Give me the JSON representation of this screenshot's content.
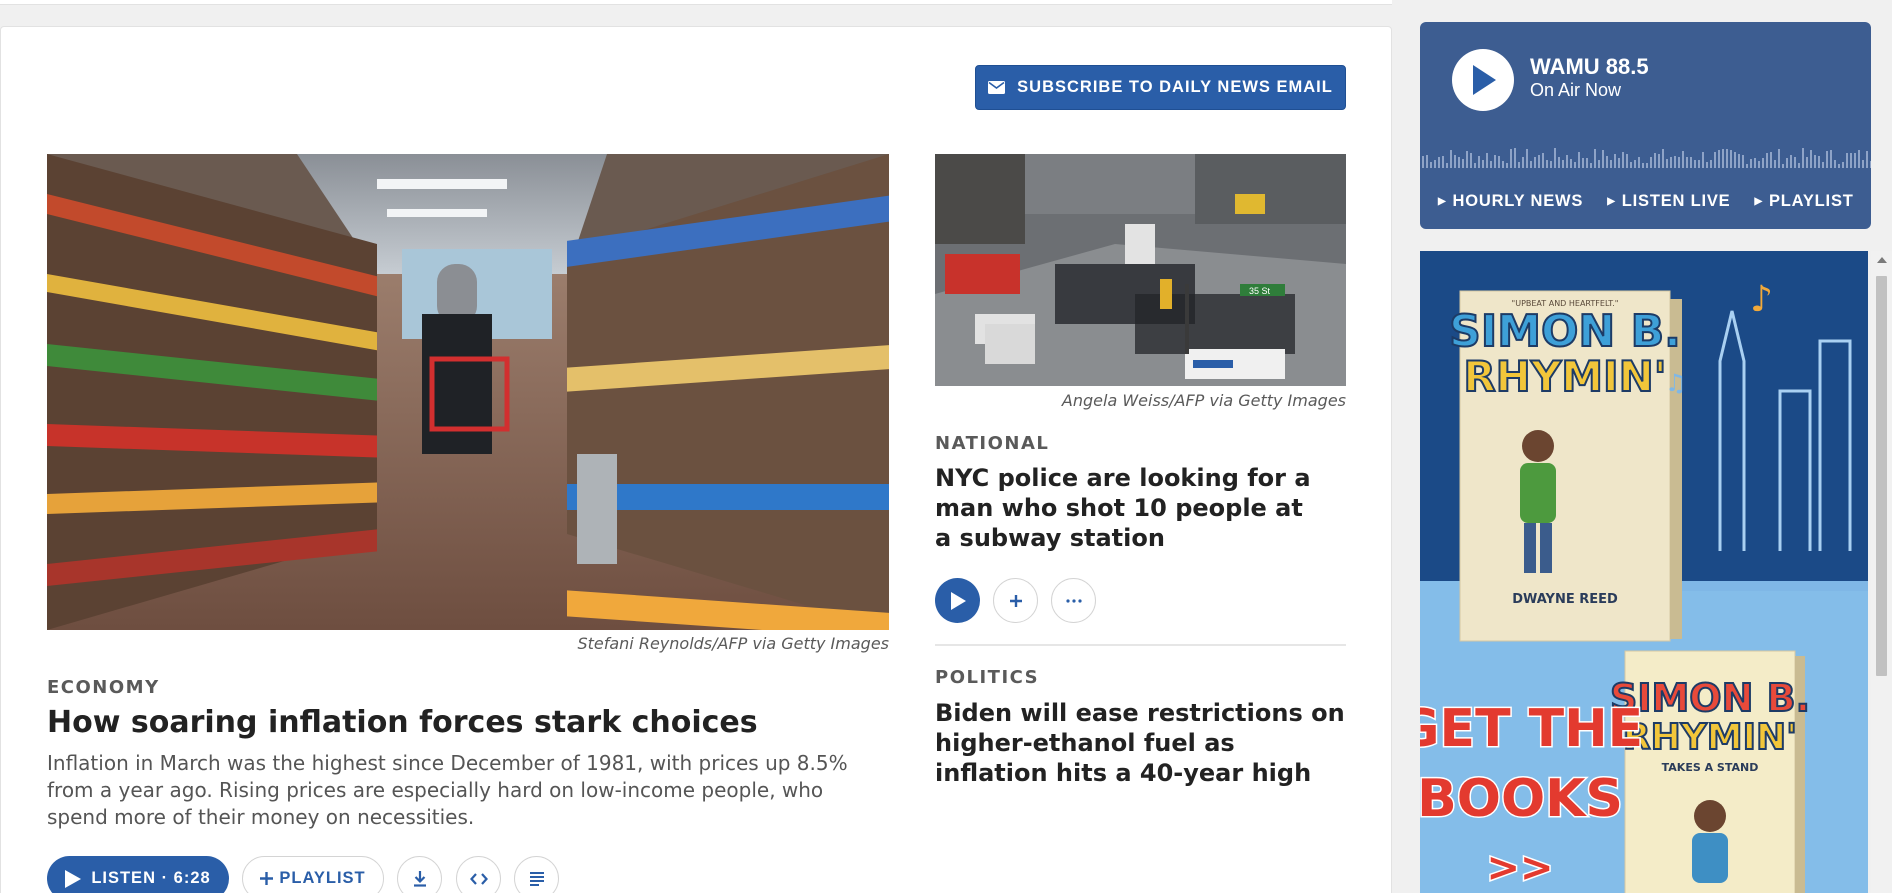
{
  "subscribe": {
    "label": "SUBSCRIBE TO DAILY NEWS EMAIL"
  },
  "lead_story": {
    "credit": "Stefani Reynolds/AFP via Getty Images",
    "kicker": "ECONOMY",
    "headline": "How soaring inflation forces stark choices",
    "teaser": "Inflation in March was the highest since December of 1981, with prices up 8.5% from a year ago. Rising prices are especially hard on low-income people, who spend more of their money on necessities.",
    "listen_label": "LISTEN · 6:28",
    "playlist_label": "PLAYLIST",
    "image_icon": "grocery-aisle-photo"
  },
  "story_2": {
    "credit": "Angela Weiss/AFP via Getty Images",
    "kicker": "NATIONAL",
    "headline": "NYC police are looking for a man who shot 10 people at a subway station",
    "image_icon": "street-police-scene-photo",
    "image_sign": "35 St"
  },
  "story_3": {
    "kicker": "POLITICS",
    "headline": "Biden will ease restrictions on higher-ethanol fuel as inflation hits a 40-year high"
  },
  "radio": {
    "station": "WAMU 88.5",
    "status": "On Air Now",
    "links": [
      "HOURLY NEWS",
      "LISTEN LIVE",
      "PLAYLIST"
    ]
  },
  "ad": {
    "book_title_1": "SIMON B.",
    "book_title_2": "RHYMIN'",
    "author": "DWAYNE REED",
    "blurb": "\"UPBEAT AND HEARTFELT.\"",
    "cta_line1": "GET THE",
    "cta_line2": "BOOKS",
    "cta_arrow": ">>",
    "sequel_subtitle": "TAKES A STAND"
  },
  "colors": {
    "accent": "#2a5ea8",
    "radio_bg": "#3d5d91"
  }
}
